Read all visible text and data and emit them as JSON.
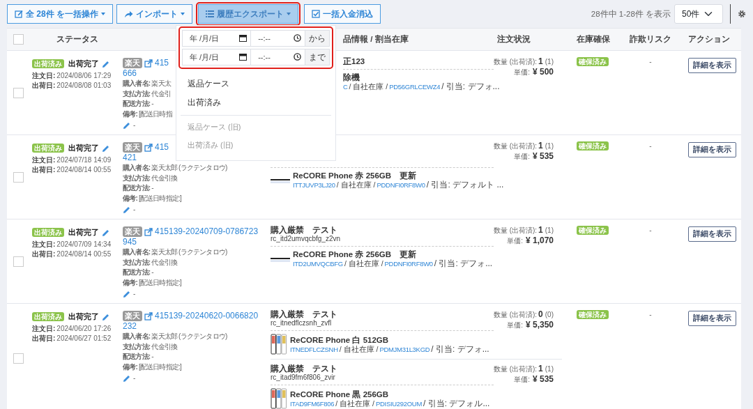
{
  "toolbar": {
    "buttons": [
      {
        "label": "全 28件 を一括操作",
        "caret": true,
        "active": false
      },
      {
        "label": "インポート",
        "caret": true,
        "active": false
      },
      {
        "label": "履歴エクスポート",
        "caret": true,
        "active": true
      },
      {
        "label": "一括入金消込",
        "caret": false,
        "active": false
      }
    ],
    "summary": "28件中 1-28件 を表示",
    "page_size": "50件"
  },
  "export_menu": {
    "ranges": [
      {
        "date_placeholder": "年 /月/日",
        "time_placeholder": "--:--",
        "suffix": "から"
      },
      {
        "date_placeholder": "年 /月/日",
        "time_placeholder": "--:--",
        "suffix": "まで"
      }
    ],
    "items": [
      {
        "label": "返品ケース",
        "disabled": false
      },
      {
        "label": "出荷済み",
        "disabled": false
      },
      {
        "label": "返品ケース (旧)",
        "disabled": true
      },
      {
        "label": "出荷済み (旧)",
        "disabled": true
      }
    ]
  },
  "table": {
    "select_all": false,
    "headers": {
      "status": "ステータス",
      "product": "品情報 / 割当在庫",
      "order_status": "注文状況",
      "stock": "在庫確保",
      "fraud_risk": "詐欺リスク",
      "action": "アクション"
    },
    "rows": [
      {
        "selected": false,
        "status_badge": "出荷済み",
        "status": "出荷完了",
        "dates": [
          {
            "label": "注文日:",
            "value": "2024/08/06 17:29"
          },
          {
            "label": "出荷日:",
            "value": "2024/08/08 01:03"
          }
        ],
        "channel": "楽天",
        "order_id": [
          "415",
          "666"
        ],
        "details": [
          "**購入者名:** 楽天太",
          "**支払方法:** 代金引",
          "**配送方法:** -",
          "**備考:** [配送日時指"
        ],
        "memo": "-",
        "items": [
          {
            "kind": "none",
            "title": "正123",
            "product": "除機",
            "item_code": "C",
            "warehouse": "/ 自社在庫 /",
            "product_code": "PD56GRLCEWZ4",
            "allocation": "/ 引当: デフォ...",
            "qty_label": "数量 (出荷済):",
            "qty": "1",
            "qty_shipped": "(1)",
            "price_label": "単価:",
            "price": "¥ 500"
          }
        ],
        "stock": "確保済み",
        "fraud": "-",
        "action": "詳細を表示"
      },
      {
        "selected": false,
        "status_badge": "出荷済み",
        "status": "出荷完了",
        "dates": [
          {
            "label": "注文日:",
            "value": "2024/07/18 14:09"
          },
          {
            "label": "出荷日:",
            "value": "2024/08/14 00:55"
          }
        ],
        "channel": "楽天",
        "order_id": [
          "415",
          "421"
        ],
        "details": [
          "**購入者名:** 楽天太郎 (ラクテンタロウ)",
          "**支払方法:** 代金引換",
          "**配送方法:** -",
          "**備考:** [配送日時指定:]"
        ],
        "memo": "-",
        "items": [
          {
            "kind": "line",
            "product": "ReCORE Phone 赤 256GB　更新",
            "item_code": "ITTJUVP3LJ20",
            "warehouse": "/ 自社在庫 /",
            "product_code": "PDDNFI0RF8W0",
            "allocation": "/ 引当: デフォルト ...",
            "qty_label": "数量 (出荷済):",
            "qty": "1",
            "qty_shipped": "(1)",
            "price_label": "単価:",
            "price": "¥ 535"
          }
        ],
        "stock": "確保済み",
        "fraud": "-",
        "action": "詳細を表示"
      },
      {
        "selected": false,
        "status_badge": "出荷済み",
        "status": "出荷完了",
        "dates": [
          {
            "label": "注文日:",
            "value": "2024/07/09 14:34"
          },
          {
            "label": "出荷日:",
            "value": "2024/08/14 00:55"
          }
        ],
        "channel": "楽天",
        "order_id": [
          "415139-20240709-0786723",
          "945"
        ],
        "details": [
          "**購入者名:** 楽天太郎 (ラクテンタロウ)",
          "**支払方法:** 代金引換",
          "**配送方法:** -",
          "**備考:** [配送日時指定:]"
        ],
        "memo": "-",
        "items": [
          {
            "kind": "line",
            "title": "購入厳禁　テスト",
            "code": "rc_itd2umvqcbfg_z2vn",
            "product": "ReCORE Phone 赤 256GB　更新",
            "item_code": "ITD2UMVQCBFG",
            "warehouse": "/ 自社在庫 /",
            "product_code": "PDDNFI0RF8W0",
            "allocation": "/ 引当: デフォ...",
            "qty_label": "数量 (出荷済):",
            "qty": "1",
            "qty_shipped": "(1)",
            "price_label": "単価:",
            "price": "¥ 1,070"
          }
        ],
        "stock": "確保済み",
        "fraud": "-",
        "action": "詳細を表示"
      },
      {
        "selected": false,
        "status_badge": "出荷済み",
        "status": "出荷完了",
        "dates": [
          {
            "label": "注文日:",
            "value": "2024/06/20 17:26"
          },
          {
            "label": "出荷日:",
            "value": "2024/06/27 01:52"
          }
        ],
        "channel": "楽天",
        "order_id": [
          "415139-20240620-0066820",
          "232"
        ],
        "details": [
          "**購入者名:** 楽天太郎 (ラクテンタロウ)",
          "**支払方法:** 代金引換",
          "**配送方法:** -",
          "**備考:** [配送日時指定:]"
        ],
        "memo": "-",
        "items": [
          {
            "kind": "phone",
            "title": "購入厳禁　テスト",
            "code": "rc_itnedflczsnh_zvfl",
            "product": "ReCORE Phone 白 512GB",
            "item_code": "ITNEDFLCZSNH",
            "warehouse": "/ 自社在庫 /",
            "product_code": "PDMJM31L3KGD",
            "allocation": "/ 引当: デフォ...",
            "qty_label": "数量 (出荷済):",
            "qty": "0",
            "qty_shipped": "(0)",
            "price_label": "単価:",
            "price": "¥ 5,350"
          },
          {
            "kind": "phone",
            "title": "購入厳禁　テスト",
            "code": "rc_itad9fm6f806_zvir",
            "product": "ReCORE Phone 黒 256GB",
            "item_code": "ITAD9FM6F806",
            "warehouse": "/ 自社在庫 /",
            "product_code": "PDISIU292OUM",
            "allocation": "/ 引当: デフォル...",
            "qty_label": "数量 (出荷済):",
            "qty": "1",
            "qty_shipped": "(1)",
            "price_label": "単価:",
            "price": "¥ 535"
          }
        ],
        "stock": "確保済み",
        "fraud": "-",
        "action": "詳細を表示"
      }
    ]
  }
}
